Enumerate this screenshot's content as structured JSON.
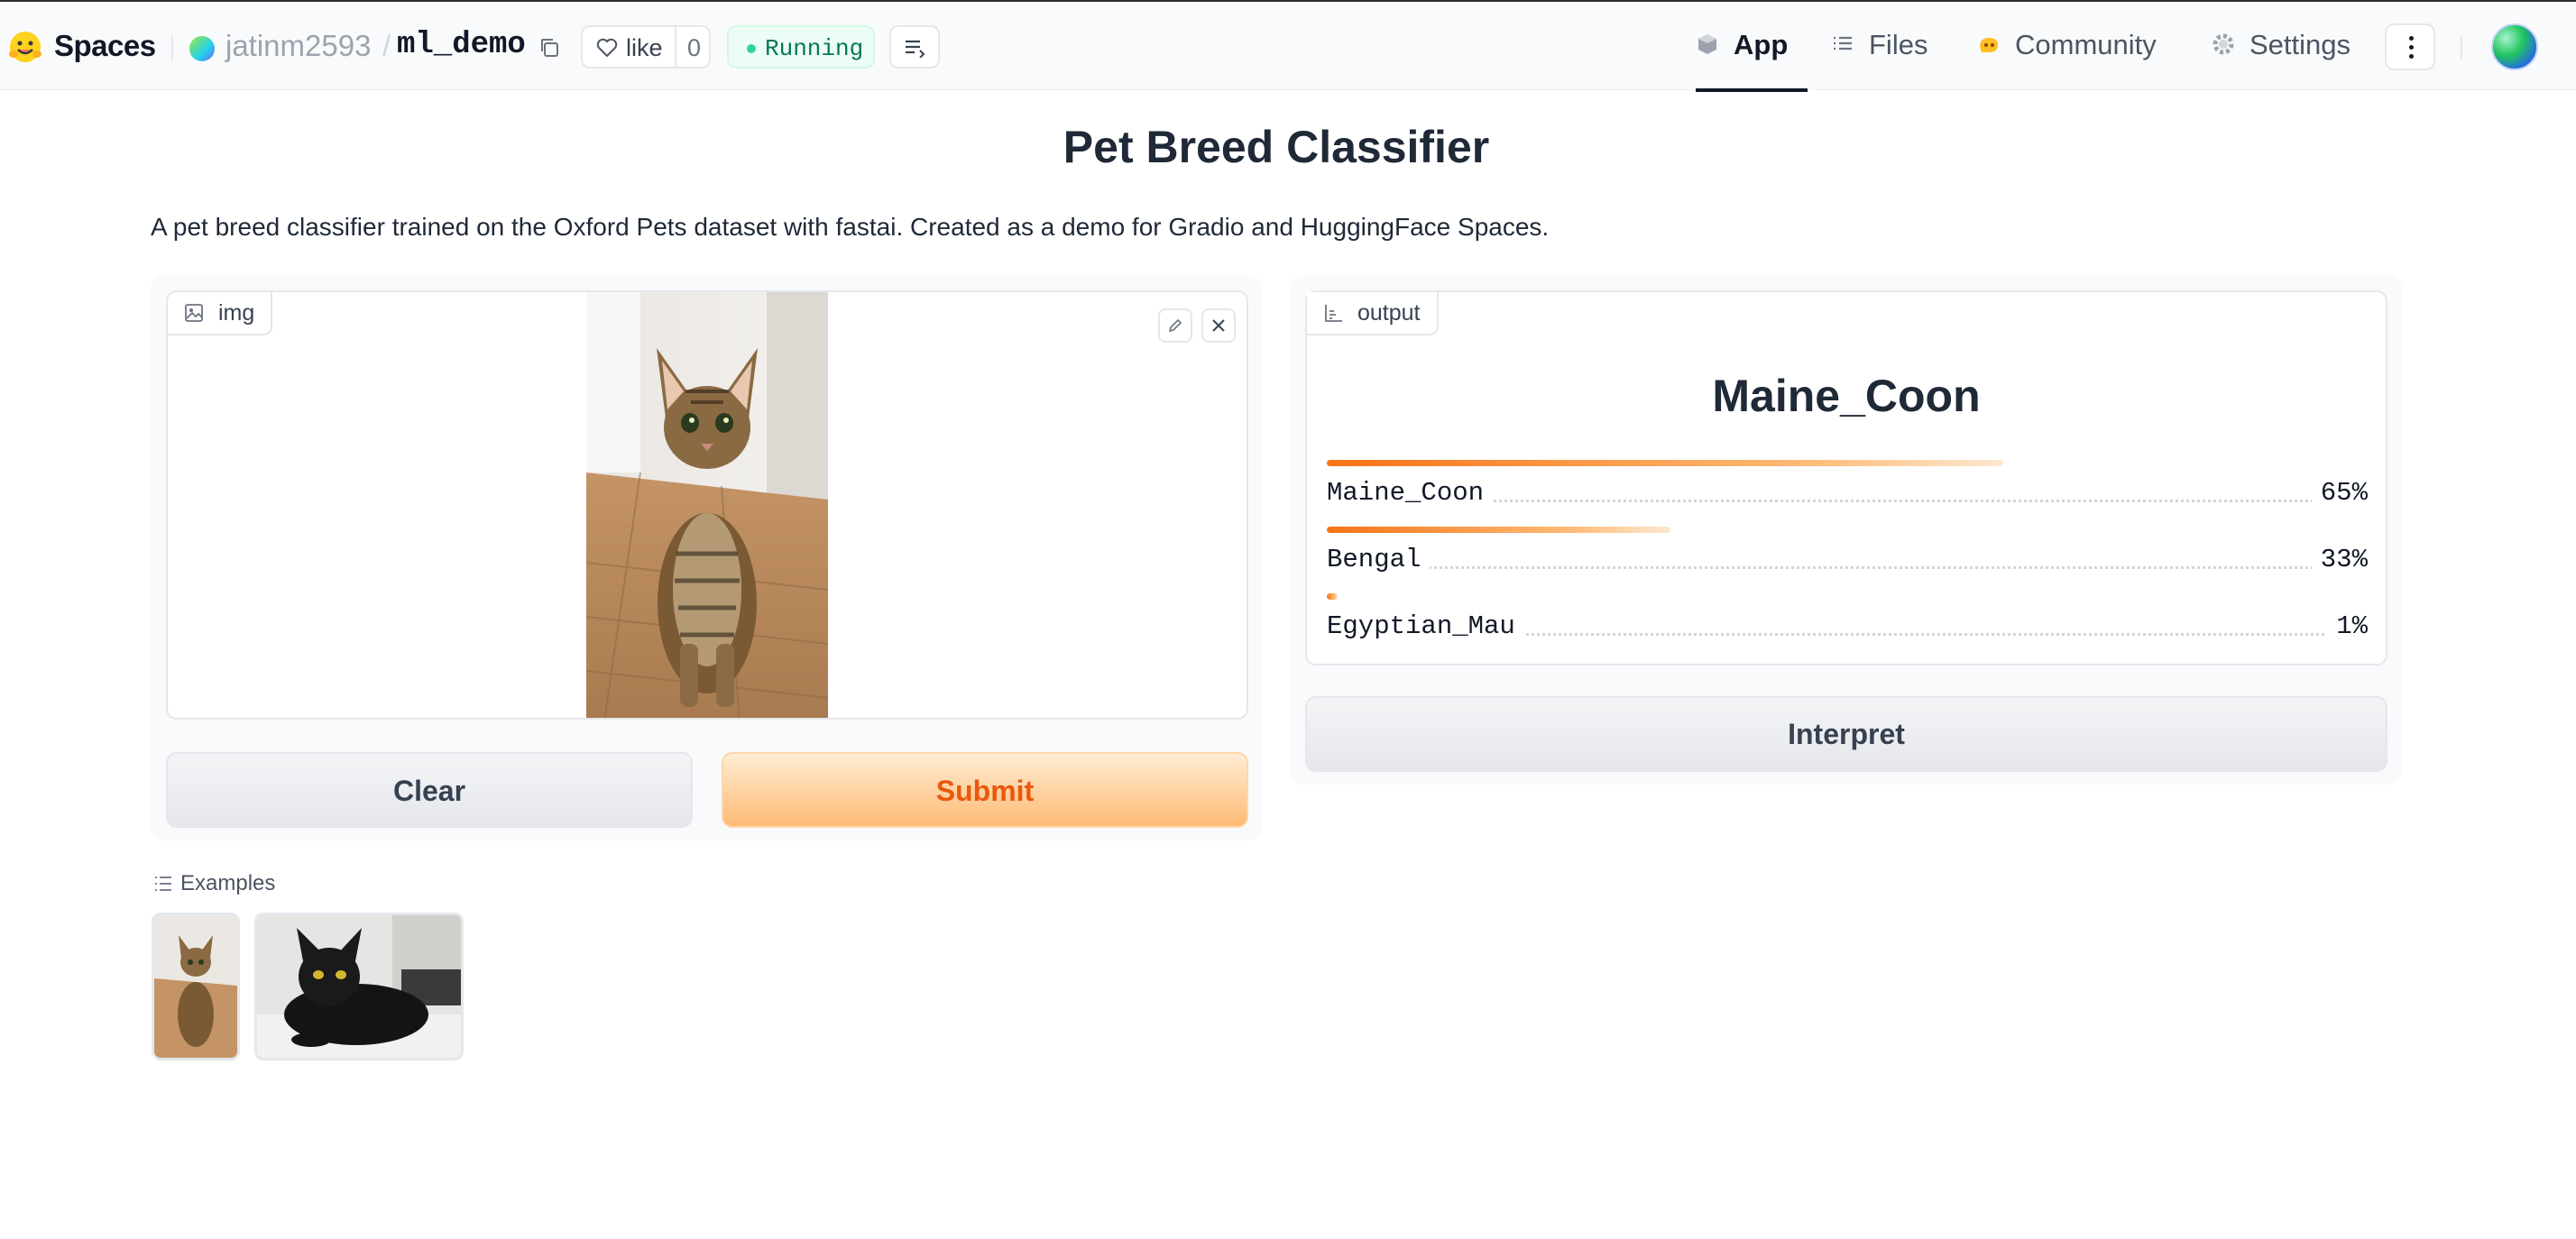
{
  "header": {
    "brand": "Spaces",
    "owner": "jatinm2593",
    "separator": "/",
    "repo": "ml_demo",
    "like_label": "like",
    "like_count": "0",
    "status": "Running",
    "tabs": [
      {
        "label": "App",
        "icon": "cube-icon",
        "active": true
      },
      {
        "label": "Files",
        "icon": "files-icon",
        "active": false
      },
      {
        "label": "Community",
        "icon": "community-icon",
        "active": false
      },
      {
        "label": "Settings",
        "icon": "gear-icon",
        "active": false
      }
    ]
  },
  "page": {
    "title": "Pet Breed Classifier",
    "description": "A pet breed classifier trained on the Oxford Pets dataset with fastai. Created as a demo for Gradio and HuggingFace Spaces."
  },
  "input": {
    "label": "img",
    "clear_label": "Clear",
    "submit_label": "Submit"
  },
  "output": {
    "label": "output",
    "top_label": "Maine_Coon",
    "confidences": [
      {
        "name": "Maine_Coon",
        "pct": "65%",
        "value": 0.65
      },
      {
        "name": "Bengal",
        "pct": "33%",
        "value": 0.33
      },
      {
        "name": "Egyptian_Mau",
        "pct": "1%",
        "value": 0.01
      }
    ],
    "interpret_label": "Interpret"
  },
  "examples": {
    "label": "Examples"
  },
  "colors": {
    "accent": "#f97316",
    "running": "#047857"
  }
}
